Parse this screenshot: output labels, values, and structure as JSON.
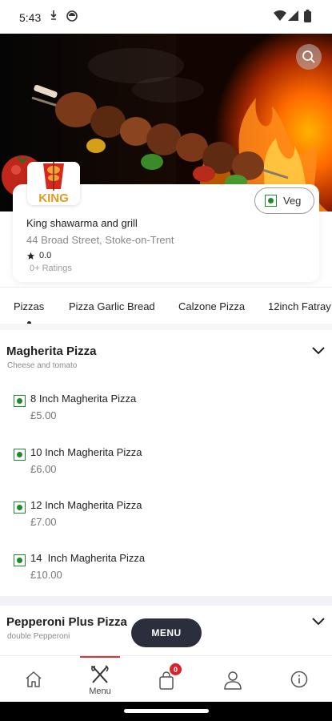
{
  "status_bar": {
    "time": "5:43"
  },
  "store": {
    "logo_text": "KING",
    "name": "King shawarma and grill",
    "address": "44 Broad Street, Stoke-on-Trent",
    "rating": "0.0",
    "ratings_count": "0+ Ratings",
    "veg_label": "Veg"
  },
  "categories": [
    "Pizzas",
    "Pizza Garlic Bread",
    "Calzone Pizza",
    "12inch Fatray"
  ],
  "sections": [
    {
      "title": "Magherita Pizza",
      "subtitle": "Cheese and tomato",
      "items": [
        {
          "name": "8 Inch Magherita Pizza",
          "price": "£5.00"
        },
        {
          "name": "10 Inch Magherita Pizza",
          "price": "£6.00"
        },
        {
          "name": "12 Inch Magherita Pizza",
          "price": "£7.00"
        },
        {
          "name": "14  Inch Magherita Pizza",
          "price": "£10.00"
        }
      ]
    },
    {
      "title": "Pepperoni Plus Pizza",
      "subtitle": "double Pepperoni"
    }
  ],
  "menu_fab": {
    "label": "MENU"
  },
  "bottom_nav": {
    "menu_label": "Menu",
    "cart_badge": "0"
  },
  "colors": {
    "veg_green": "#1d8a2c",
    "accent_red": "#e2323a",
    "fab_bg": "#2b2f3d"
  }
}
